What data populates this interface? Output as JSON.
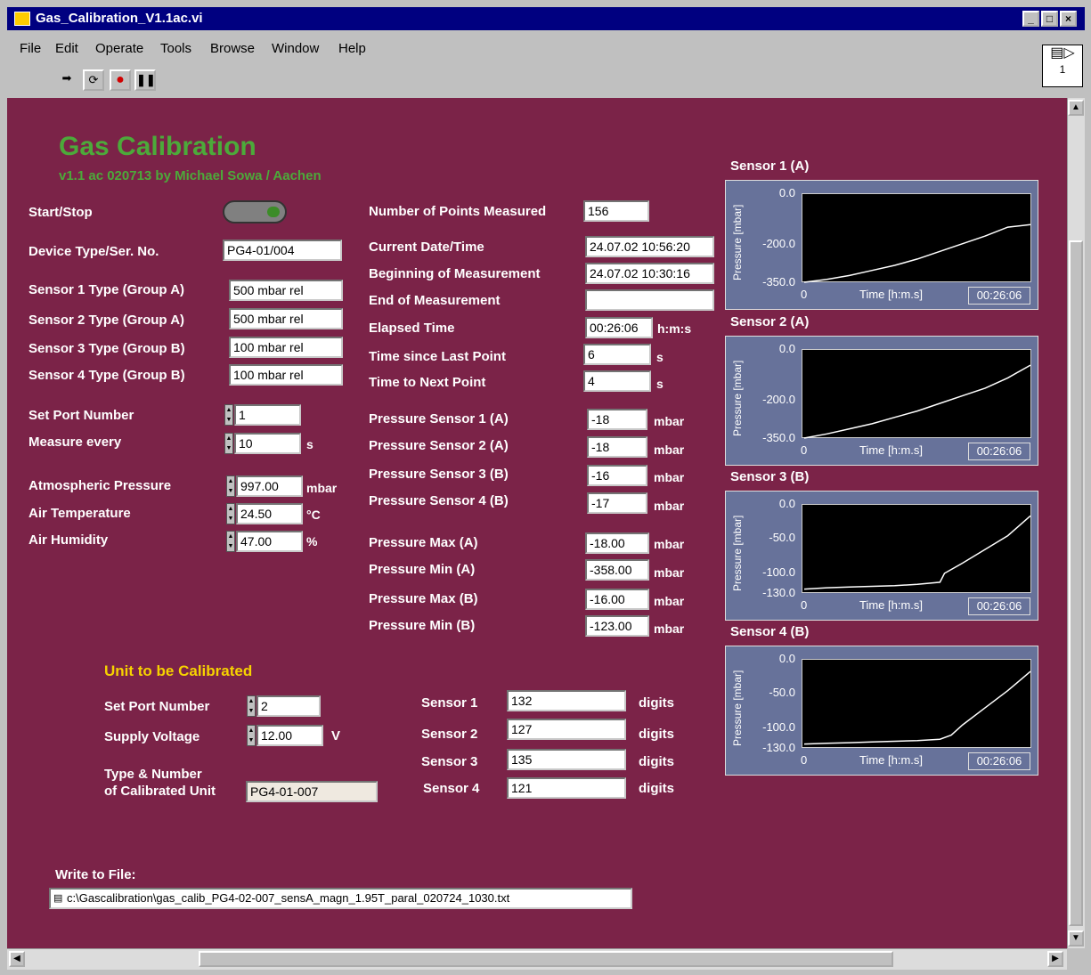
{
  "window": {
    "title": "Gas_Calibration_V1.1ac.vi"
  },
  "menu": [
    "File",
    "Edit",
    "Operate",
    "Tools",
    "Browse",
    "Window",
    "Help"
  ],
  "vi_icon_label": "1",
  "header": {
    "title": "Gas Calibration",
    "subtitle": "v1.1 ac 020713  by Michael Sowa / Aachen"
  },
  "left": {
    "start_stop": "Start/Stop",
    "device_label": "Device Type/Ser. No.",
    "device_value": "PG4-01/004",
    "s1_label": "Sensor 1 Type (Group A)",
    "s1_value": "500 mbar rel",
    "s2_label": "Sensor 2 Type (Group A)",
    "s2_value": "500 mbar rel",
    "s3_label": "Sensor 3 Type (Group B)",
    "s3_value": "100 mbar rel",
    "s4_label": "Sensor 4 Type (Group B)",
    "s4_value": "100 mbar rel",
    "port_label": "Set Port Number",
    "port_value": "1",
    "measure_label": "Measure every",
    "measure_value": "10",
    "measure_unit": "s",
    "atm_label": "Atmospheric Pressure",
    "atm_value": "997.00",
    "atm_unit": "mbar",
    "temp_label": "Air Temperature",
    "temp_value": "24.50",
    "temp_unit": "°C",
    "hum_label": "Air Humidity",
    "hum_value": "47.00",
    "hum_unit": "%"
  },
  "mid": {
    "points_label": "Number of Points Measured",
    "points_value": "156",
    "date_label": "Current Date/Time",
    "date_value": "24.07.02 10:56:20",
    "begin_label": "Beginning of Measurement",
    "begin_value": "24.07.02 10:30:16",
    "end_label": "End of Measurement",
    "end_value": "",
    "elapsed_label": "Elapsed Time",
    "elapsed_value": "00:26:06",
    "elapsed_unit": "h:m:s",
    "since_label": "Time since Last Point",
    "since_value": "6",
    "since_unit": "s",
    "next_label": "Time to Next Point",
    "next_value": "4",
    "next_unit": "s",
    "p1_label": "Pressure Sensor 1 (A)",
    "p1_value": "-18",
    "p2_label": "Pressure Sensor 2 (A)",
    "p2_value": "-18",
    "p3_label": "Pressure Sensor 3 (B)",
    "p3_value": "-16",
    "p4_label": "Pressure Sensor 4 (B)",
    "p4_value": "-17",
    "maxa_label": "Pressure Max (A)",
    "maxa_value": "-18.00",
    "mina_label": "Pressure Min (A)",
    "mina_value": "-358.00",
    "maxb_label": "Pressure Max (B)",
    "maxb_value": "-16.00",
    "minb_label": "Pressure Min (B)",
    "minb_value": "-123.00",
    "mbar": "mbar"
  },
  "unit": {
    "title": "Unit to be Calibrated",
    "port_label": "Set Port Number",
    "port_value": "2",
    "volt_label": "Supply Voltage",
    "volt_value": "12.00",
    "volt_unit": "V",
    "type_label_1": "Type & Number",
    "type_label_2": "of Calibrated Unit",
    "type_value": "PG4-01-007",
    "sensors": [
      {
        "label": "Sensor 1",
        "value": "132"
      },
      {
        "label": "Sensor 2",
        "value": "127"
      },
      {
        "label": "Sensor 3",
        "value": "135"
      },
      {
        "label": "Sensor 4",
        "value": "121"
      }
    ],
    "digits": "digits"
  },
  "file": {
    "label": "Write to File:",
    "path": "c:\\Gascalibration\\gas_calib_PG4-02-007_sensA_magn_1.95T_paral_020724_1030.txt"
  },
  "chart_data": [
    {
      "type": "line",
      "title": "Sensor 1 (A)",
      "ylabel": "Pressure [mbar]",
      "xlabel": "Time [h:m.s]",
      "x_start_label": "0",
      "x_end_label": "00:26:06",
      "ylim": [
        -350,
        0
      ],
      "yticks": [
        "0.0",
        "-200.0",
        "-350.0"
      ],
      "x": [
        0,
        0.1,
        0.2,
        0.3,
        0.4,
        0.5,
        0.6,
        0.7,
        0.8,
        0.9,
        1.0
      ],
      "y": [
        -350,
        -335,
        -320,
        -300,
        -280,
        -255,
        -225,
        -195,
        -165,
        -130,
        -120
      ]
    },
    {
      "type": "line",
      "title": "Sensor 2 (A)",
      "ylabel": "Pressure [mbar]",
      "xlabel": "Time [h:m.s]",
      "x_start_label": "0",
      "x_end_label": "00:26:06",
      "ylim": [
        -350,
        0
      ],
      "yticks": [
        "0.0",
        "-200.0",
        "-350.0"
      ],
      "x": [
        0,
        0.1,
        0.2,
        0.3,
        0.4,
        0.5,
        0.6,
        0.7,
        0.8,
        0.9,
        1.0
      ],
      "y": [
        -350,
        -330,
        -310,
        -290,
        -265,
        -240,
        -210,
        -180,
        -150,
        -110,
        -60
      ]
    },
    {
      "type": "line",
      "title": "Sensor 3 (B)",
      "ylabel": "Pressure [mbar]",
      "xlabel": "Time [h:m.s]",
      "x_start_label": "0",
      "x_end_label": "00:26:06",
      "ylim": [
        -130,
        0
      ],
      "yticks": [
        "0.0",
        "-50.0",
        "-100.0",
        "-130.0"
      ],
      "x": [
        0,
        0.1,
        0.2,
        0.3,
        0.4,
        0.5,
        0.6,
        0.62,
        0.7,
        0.8,
        0.9,
        1.0
      ],
      "y": [
        -123,
        -121,
        -120,
        -119,
        -118,
        -116,
        -113,
        -100,
        -85,
        -65,
        -45,
        -16
      ]
    },
    {
      "type": "line",
      "title": "Sensor 4 (B)",
      "ylabel": "Pressure [mbar]",
      "xlabel": "Time [h:m.s]",
      "x_start_label": "0",
      "x_end_label": "00:26:06",
      "ylim": [
        -130,
        0
      ],
      "yticks": [
        "0.0",
        "-50.0",
        "-100.0",
        "-130.0"
      ],
      "x": [
        0,
        0.1,
        0.2,
        0.3,
        0.4,
        0.5,
        0.6,
        0.65,
        0.7,
        0.8,
        0.9,
        1.0
      ],
      "y": [
        -123,
        -122,
        -121,
        -120,
        -119,
        -118,
        -116,
        -110,
        -95,
        -70,
        -45,
        -17
      ]
    }
  ]
}
